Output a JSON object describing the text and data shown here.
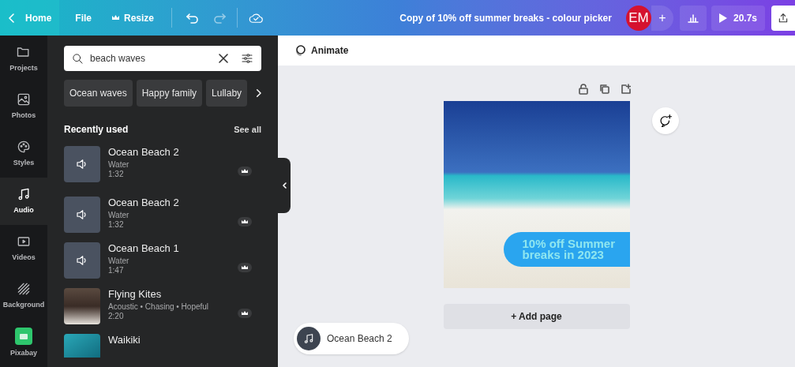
{
  "topbar": {
    "home": "Home",
    "file": "File",
    "resize": "Resize",
    "title": "Copy of 10% off summer breaks - colour picker",
    "avatar": "EM",
    "add": "+",
    "play_time": "20.7s"
  },
  "rail": [
    {
      "label": "Projects",
      "selected": false
    },
    {
      "label": "Photos",
      "selected": false
    },
    {
      "label": "Styles",
      "selected": false
    },
    {
      "label": "Audio",
      "selected": true
    },
    {
      "label": "Videos",
      "selected": false
    },
    {
      "label": "Background",
      "selected": false
    },
    {
      "label": "Pixabay",
      "selected": false
    }
  ],
  "search": {
    "value": "beach waves"
  },
  "suggestions": [
    "Ocean waves",
    "Happy family",
    "Lullaby"
  ],
  "section": {
    "title": "Recently used",
    "link": "See all"
  },
  "tracks": [
    {
      "kind": "sound",
      "title": "Ocean Beach 2",
      "subtitle": "Water",
      "duration": "1:32"
    },
    {
      "kind": "sound",
      "title": "Ocean Beach 2",
      "subtitle": "Water",
      "duration": "1:32"
    },
    {
      "kind": "sound",
      "title": "Ocean Beach 1",
      "subtitle": "Water",
      "duration": "1:47"
    },
    {
      "kind": "image",
      "title": "Flying Kites",
      "subtitle": "Acoustic • Chasing • Hopeful",
      "duration": "2:20"
    },
    {
      "kind": "photo",
      "title": "Waikiki"
    }
  ],
  "toolbar": {
    "animate": "Animate"
  },
  "design": {
    "headline": "10% off Summer breaks in 2023"
  },
  "add_page": "+ Add page",
  "now_playing": "Ocean Beach 2"
}
